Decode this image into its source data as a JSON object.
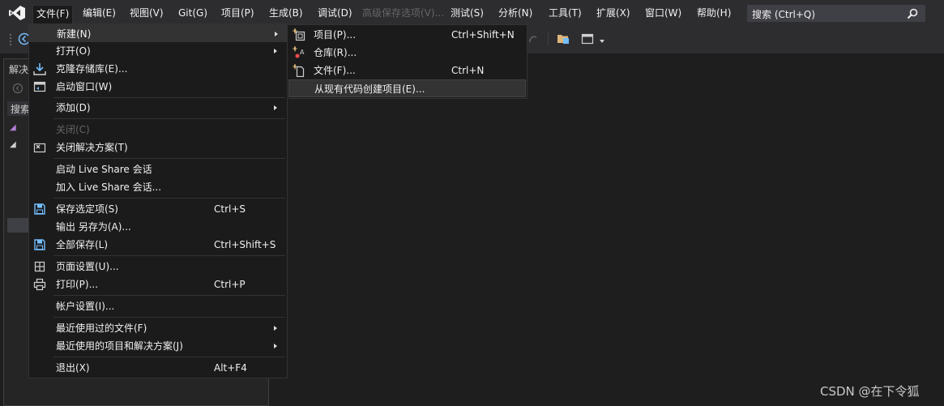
{
  "menubar": {
    "items": [
      {
        "label": "文件(F)"
      },
      {
        "label": "编辑(E)"
      },
      {
        "label": "视图(V)"
      },
      {
        "label": "Git(G)"
      },
      {
        "label": "项目(P)"
      },
      {
        "label": "生成(B)"
      },
      {
        "label": "调试(D)"
      },
      {
        "label": "高级保存选项(V)..."
      },
      {
        "label": "测试(S)"
      },
      {
        "label": "分析(N)"
      },
      {
        "label": "工具(T)"
      },
      {
        "label": "扩展(X)"
      },
      {
        "label": "窗口(W)"
      },
      {
        "label": "帮助(H)"
      }
    ],
    "search_label": "搜索 (Ctrl+Q)"
  },
  "solution_explorer": {
    "title": "解决",
    "search_label": "搜索"
  },
  "file_menu": {
    "items": [
      {
        "label": "新建(N)",
        "shortcut": "",
        "icon": "none"
      },
      {
        "label": "打开(O)",
        "shortcut": "",
        "icon": "none"
      },
      {
        "label": "克隆存储库(E)...",
        "shortcut": "",
        "icon": "download-icon"
      },
      {
        "label": "启动窗口(W)",
        "shortcut": "",
        "icon": "start-window-icon"
      },
      {
        "label": "添加(D)",
        "shortcut": "",
        "icon": "none"
      },
      {
        "label": "关闭(C)",
        "shortcut": "",
        "icon": "none"
      },
      {
        "label": "关闭解决方案(T)",
        "shortcut": "",
        "icon": "close-solution-icon"
      },
      {
        "label": "启动 Live Share 会话",
        "shortcut": "",
        "icon": "none"
      },
      {
        "label": "加入 Live Share 会话...",
        "shortcut": "",
        "icon": "none"
      },
      {
        "label": "保存选定项(S)",
        "shortcut": "Ctrl+S",
        "icon": "save-icon"
      },
      {
        "label": "输出 另存为(A)...",
        "shortcut": "",
        "icon": "none"
      },
      {
        "label": "全部保存(L)",
        "shortcut": "Ctrl+Shift+S",
        "icon": "save-all-icon"
      },
      {
        "label": "页面设置(U)...",
        "shortcut": "",
        "icon": "page-setup-icon"
      },
      {
        "label": "打印(P)...",
        "shortcut": "Ctrl+P",
        "icon": "print-icon"
      },
      {
        "label": "帐户设置(I)...",
        "shortcut": "",
        "icon": "none"
      },
      {
        "label": "最近使用过的文件(F)",
        "shortcut": "",
        "icon": "none"
      },
      {
        "label": "最近使用的项目和解决方案(J)",
        "shortcut": "",
        "icon": "none"
      },
      {
        "label": "退出(X)",
        "shortcut": "Alt+F4",
        "icon": "none"
      }
    ]
  },
  "new_submenu": {
    "items": [
      {
        "label": "项目(P)...",
        "shortcut": "Ctrl+Shift+N",
        "icon": "new-project-icon"
      },
      {
        "label": "仓库(R)...",
        "shortcut": "",
        "icon": "repository-icon"
      },
      {
        "label": "文件(F)...",
        "shortcut": "Ctrl+N",
        "icon": "new-file-icon"
      },
      {
        "label": "从现有代码创建项目(E)...",
        "shortcut": "",
        "icon": "none"
      }
    ]
  },
  "watermark": "CSDN @在下令狐",
  "colors": {
    "background": "#1e1e1e",
    "menubar": "#2d2d30",
    "menu_bg": "#1b1b1c",
    "highlight": "#333334",
    "accent_purple": "#b180d7",
    "icon_blue": "#75beff"
  }
}
